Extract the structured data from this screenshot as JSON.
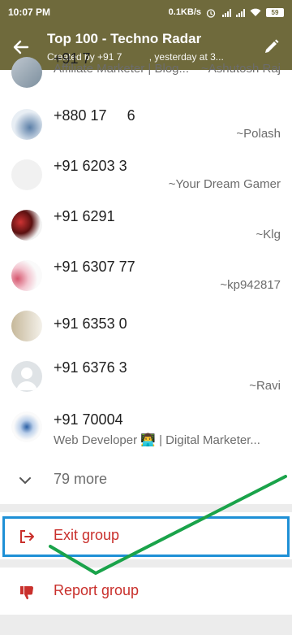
{
  "status_bar": {
    "time": "10:07 PM",
    "net_speed": "0.1KB/s",
    "battery": "59"
  },
  "header": {
    "title": "Top 100 - Techno Radar",
    "subtitle": "Created by +91 7     , yesterday at 3..."
  },
  "participants": [
    {
      "phone": "+91 7        ",
      "about": "Affiliate Marketer | Blog...",
      "nick": "~Ashutosh Raj",
      "avatar": "photo"
    },
    {
      "phone": "+880 17   6     ",
      "about": "",
      "nick": "~Polash",
      "avatar": "photo"
    },
    {
      "phone": "+91 6203 3    ",
      "about": "",
      "nick": "~Your Dream Gamer",
      "avatar": "photo"
    },
    {
      "phone": "+91 6291    ",
      "about": "",
      "nick": "~Klg",
      "avatar": "photo"
    },
    {
      "phone": "+91 6307 77     ",
      "about": "",
      "nick": "~kp942817",
      "avatar": "photo"
    },
    {
      "phone": "+91 6353 0     ",
      "about": "",
      "nick": "",
      "avatar": "photo"
    },
    {
      "phone": "+91 6376 3     ",
      "about": "",
      "nick": "~Ravi",
      "avatar": "default"
    },
    {
      "phone": "+91 70004     ",
      "about": "Web Developer 👨‍💻 | Digital Marketer...",
      "nick": "",
      "avatar": "photo"
    }
  ],
  "more": {
    "label": "79 more"
  },
  "actions": {
    "exit_label": "Exit group",
    "report_label": "Report group"
  },
  "colors": {
    "header": "#6f6a3c",
    "danger": "#c9302c",
    "highlight": "#1e90d6",
    "annotation": "#1aa34a"
  },
  "icons": {
    "back": "arrow-left-icon",
    "edit": "pencil-icon",
    "more": "chevron-down-icon",
    "exit": "exit-icon",
    "report": "thumbs-down-icon"
  }
}
